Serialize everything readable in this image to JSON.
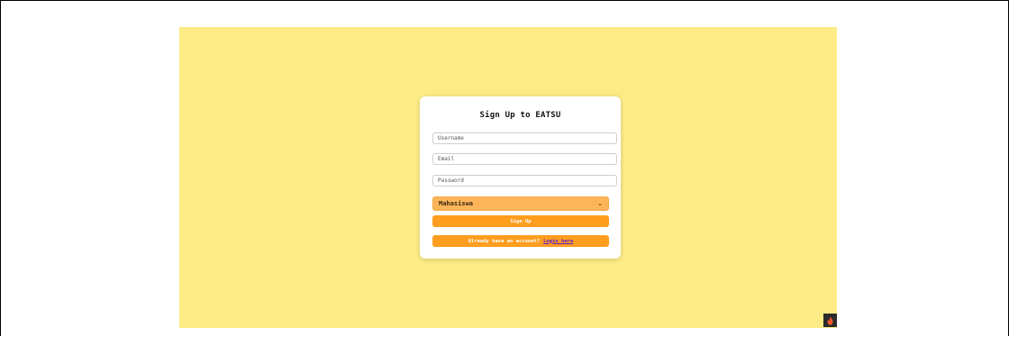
{
  "form": {
    "title": "Sign Up to EATSU",
    "username_placeholder": "Username",
    "email_placeholder": "Email",
    "password_placeholder": "Password",
    "role_selected": "Mahasiswa",
    "signup_label": "Sign Up",
    "login_prompt": "Already have an account?",
    "login_link": "Login here"
  },
  "icons": {
    "role_dropdown": "chevron-down-icon",
    "corner_badge": "flame-icon"
  },
  "colors": {
    "page_background": "#fdec86",
    "accent": "#ff9d1e",
    "select_background": "#fdb55a",
    "link": "#5a1fc7"
  }
}
